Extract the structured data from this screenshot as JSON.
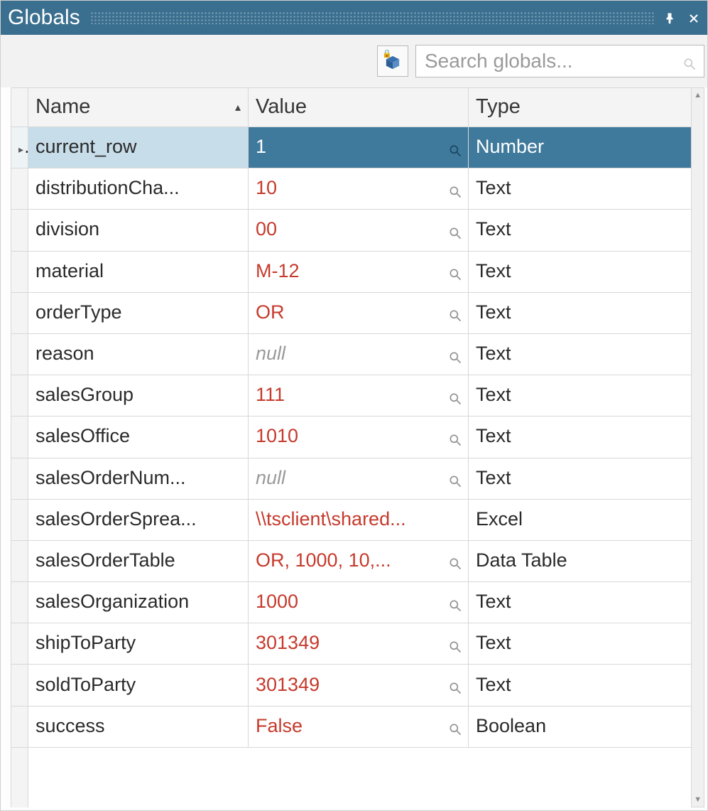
{
  "titlebar": {
    "title": "Globals"
  },
  "toolbar": {
    "search_placeholder": "Search globals...",
    "search_value": ""
  },
  "grid": {
    "columns": {
      "name": "Name",
      "value": "Value",
      "type": "Type"
    },
    "sorted_column": "name",
    "sort_direction": "asc",
    "selected_index": 0,
    "rows": [
      {
        "name": "current_row",
        "value": "1",
        "is_null": false,
        "has_mag": true,
        "type": "Number"
      },
      {
        "name": "distributionCha...",
        "value": "10",
        "is_null": false,
        "has_mag": true,
        "type": "Text"
      },
      {
        "name": "division",
        "value": "00",
        "is_null": false,
        "has_mag": true,
        "type": "Text"
      },
      {
        "name": "material",
        "value": "M-12",
        "is_null": false,
        "has_mag": true,
        "type": "Text"
      },
      {
        "name": "orderType",
        "value": "OR",
        "is_null": false,
        "has_mag": true,
        "type": "Text"
      },
      {
        "name": "reason",
        "value": "null",
        "is_null": true,
        "has_mag": true,
        "type": "Text"
      },
      {
        "name": "salesGroup",
        "value": "111",
        "is_null": false,
        "has_mag": true,
        "type": "Text"
      },
      {
        "name": "salesOffice",
        "value": "1010",
        "is_null": false,
        "has_mag": true,
        "type": "Text"
      },
      {
        "name": "salesOrderNum...",
        "value": "null",
        "is_null": true,
        "has_mag": true,
        "type": "Text"
      },
      {
        "name": "salesOrderSprea...",
        "value": "\\\\tsclient\\shared...",
        "is_null": false,
        "has_mag": false,
        "type": "Excel"
      },
      {
        "name": "salesOrderTable",
        "value": "OR, 1000, 10,...",
        "is_null": false,
        "has_mag": true,
        "type": "Data Table"
      },
      {
        "name": "salesOrganization",
        "value": "1000",
        "is_null": false,
        "has_mag": true,
        "type": "Text"
      },
      {
        "name": "shipToParty",
        "value": "301349",
        "is_null": false,
        "has_mag": true,
        "type": "Text"
      },
      {
        "name": "soldToParty",
        "value": "301349",
        "is_null": false,
        "has_mag": true,
        "type": "Text"
      },
      {
        "name": "success",
        "value": "False",
        "is_null": false,
        "has_mag": true,
        "type": "Boolean"
      }
    ]
  }
}
